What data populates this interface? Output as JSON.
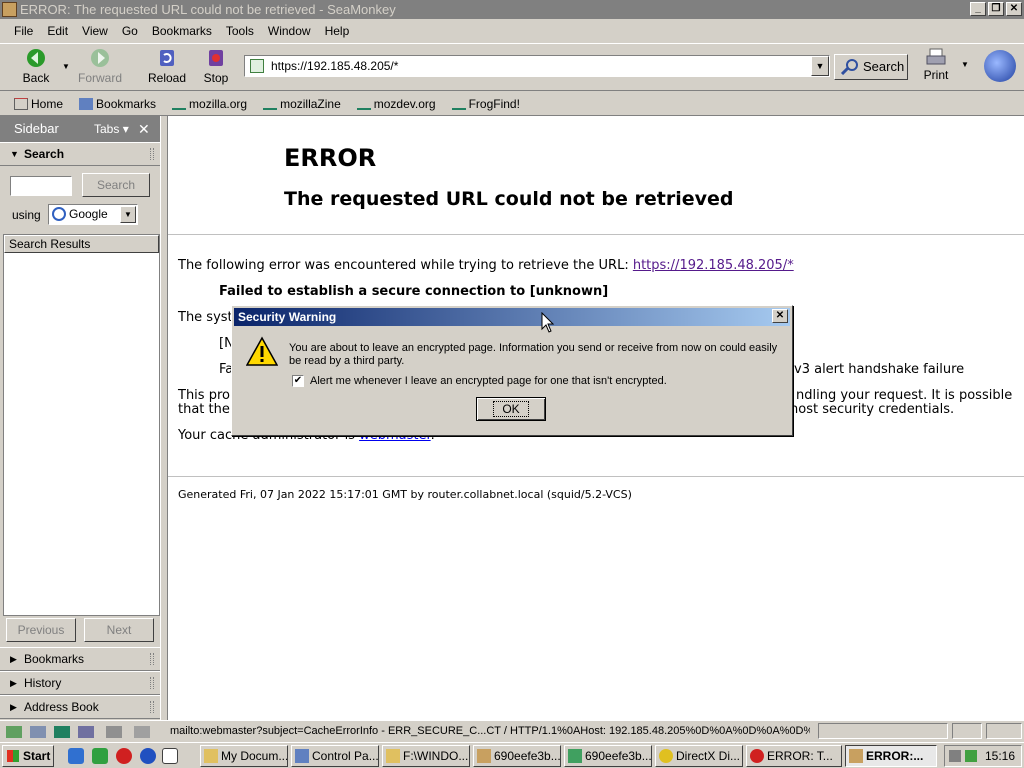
{
  "window": {
    "title": "ERROR: The requested URL could not be retrieved - SeaMonkey"
  },
  "menu": [
    "File",
    "Edit",
    "View",
    "Go",
    "Bookmarks",
    "Tools",
    "Window",
    "Help"
  ],
  "toolbar": {
    "back": "Back",
    "forward": "Forward",
    "reload": "Reload",
    "stop": "Stop",
    "url": "https://192.185.48.205/*",
    "search": "Search",
    "print": "Print"
  },
  "personal": [
    "Home",
    "Bookmarks",
    "mozilla.org",
    "mozillaZine",
    "mozdev.org",
    "FrogFind!"
  ],
  "sidebar": {
    "title": "Sidebar",
    "tabs": "Tabs",
    "search_header": "Search",
    "search_button": "Search",
    "using": "using",
    "engine": "Google",
    "results_header": "Search Results",
    "previous": "Previous",
    "next": "Next",
    "panels": [
      "Bookmarks",
      "History",
      "Address Book"
    ]
  },
  "page": {
    "h1": "ERROR",
    "h2": "The requested URL could not be retrieved",
    "line1_prefix": "The following error was encountered while trying to retrieve the URL: ",
    "line1_link": "https://192.185.48.205/*",
    "failed": "Failed to establish a secure connection to [unknown]",
    "syst": "The syst",
    "bracket_n": "[N",
    "paren_right": ")",
    "fa": "Fa",
    "handshake": "v3 alert handshake failure",
    "proxy1_left": "This pro",
    "proxy1_right": "ndling your request. It is possible",
    "proxy2_left": "that the",
    "proxy2_right": "host security credentials.",
    "admin_prefix": "Your cache administrator is ",
    "admin_link": "webmaster",
    "admin_suffix": ".",
    "generated": "Generated Fri, 07 Jan 2022 15:17:01 GMT by router.collabnet.local (squid/5.2-VCS)"
  },
  "dialog": {
    "title": "Security Warning",
    "message": "You are about to leave an encrypted page. Information you send or receive from now on could easily be read by a third party.",
    "checkbox": "Alert me whenever I leave an encrypted page for one that isn't encrypted.",
    "checked": true,
    "ok": "OK"
  },
  "status": {
    "text": "mailto:webmaster?subject=CacheErrorInfo - ERR_SECURE_C...CT / HTTP/1.1%0AHost: 192.185.48.205%0D%0A%0D%0A%0D%0A"
  },
  "taskbar": {
    "start": "Start",
    "tasks": [
      "My Docum...",
      "Control Pa...",
      "F:\\WINDO...",
      "690eefe3b...",
      "690eefe3b...",
      "DirectX Di...",
      "ERROR: T...",
      "ERROR:..."
    ],
    "clock": "15:16"
  }
}
